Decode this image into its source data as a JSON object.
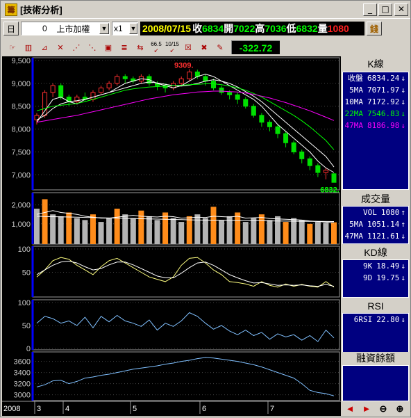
{
  "window": {
    "icon_glyph": "籌",
    "title": "[技術分析]",
    "minimize_glyph": "_",
    "maximize_glyph": "□",
    "close_glyph": "✕"
  },
  "quote_bar": {
    "period": "日",
    "symbol_code": "0",
    "symbol_name": "上市加權",
    "multiplier": "x1",
    "date": "2008/07/15",
    "close_label": "收",
    "close_value": "6834",
    "open_label": "開",
    "open_value": "7022",
    "high_label": "高",
    "high_value": "7036",
    "low_label": "低",
    "low_value": "6832",
    "volume_label": "量",
    "volume_value": "1080",
    "right_icon": "錢"
  },
  "toolbar": {
    "change": "-322.72",
    "tool_icons": [
      "cursor-icon",
      "k-chart-icon",
      "line-chart-icon",
      "trendline-icon",
      "fan-icon",
      "fan-up-icon",
      "box-icon",
      "channel-icon",
      "swap-icon",
      "date-range-icon",
      "fib-icon",
      "pencil-icon"
    ],
    "tool_texts": [
      "66.5",
      "10/15"
    ]
  },
  "panels": {
    "kline": {
      "title": "K線",
      "rows": [
        {
          "label": "收盤",
          "value": "6834.24",
          "arrow": "↓",
          "color": "#ffffff"
        },
        {
          "label": "5MA",
          "value": "7071.97",
          "arrow": "↓",
          "color": "#ffffff"
        },
        {
          "label": "10MA",
          "value": "7172.92",
          "arrow": "↓",
          "color": "#ffffff"
        },
        {
          "label": "22MA",
          "value": "7546.83",
          "arrow": "↓",
          "color": "#00ff00"
        },
        {
          "label": "47MA",
          "value": "8186.98",
          "arrow": "↓",
          "color": "#ff00ff"
        }
      ]
    },
    "volume": {
      "title": "成交量",
      "rows": [
        {
          "label": "VOL",
          "value": "1080",
          "arrow": "↑",
          "color": "#ffffff"
        },
        {
          "label": "5MA",
          "value": "1051.14",
          "arrow": "↑",
          "color": "#ffffff"
        },
        {
          "label": "47MA",
          "value": "1121.61",
          "arrow": "↓",
          "color": "#ffffff"
        }
      ]
    },
    "kd": {
      "title": "KD線",
      "rows": [
        {
          "label": "9K",
          "value": "18.49",
          "arrow": "↓",
          "color": "#ffffff"
        },
        {
          "label": "9D",
          "value": "19.75",
          "arrow": "↓",
          "color": "#ffffff"
        }
      ]
    },
    "rsi": {
      "title": "RSI",
      "rows": [
        {
          "label": "6RSI",
          "value": "22.80",
          "arrow": "↓",
          "color": "#ffffff"
        }
      ]
    },
    "margin": {
      "title": "融資餘額"
    }
  },
  "nav": {
    "left_glyph": "◄",
    "right_glyph": "►",
    "zoom_out_glyph": "⊖",
    "zoom_in_glyph": "⊕"
  },
  "chart_data": [
    {
      "type": "candlestick",
      "title": "K線",
      "yticks": [
        "9,500",
        "9,000",
        "8,500",
        "8,000",
        "7,500",
        "7,000"
      ],
      "ylim": [
        6700,
        9500
      ],
      "annotations": [
        "9309.",
        "6832."
      ],
      "x_labels": [
        "2008",
        "3",
        "4",
        "5",
        "6",
        "7"
      ],
      "ma_series": [
        {
          "name": "5MA",
          "color": "#ffffff",
          "values": [
            8150,
            8400,
            8650,
            8700,
            8600,
            8550,
            8650,
            8700,
            8750,
            8800,
            8900,
            9000,
            9050,
            9100,
            9080,
            9000,
            8950,
            8900,
            8950,
            9050,
            9150,
            9200,
            9150,
            9050,
            8950,
            8850,
            8750,
            8650,
            8500,
            8300,
            8100,
            7950,
            7800,
            7650,
            7500,
            7300,
            7150,
            7050
          ]
        },
        {
          "name": "10MA",
          "color": "#ffffff",
          "values": [
            8200,
            8300,
            8450,
            8550,
            8600,
            8620,
            8650,
            8700,
            8750,
            8800,
            8850,
            8900,
            8950,
            9000,
            9030,
            9010,
            8980,
            8950,
            8940,
            8960,
            9000,
            9050,
            9080,
            9050,
            9000,
            8920,
            8820,
            8720,
            8600,
            8450,
            8300,
            8150,
            8000,
            7850,
            7700,
            7550,
            7400,
            7170
          ]
        },
        {
          "name": "22MA",
          "color": "#00ff00",
          "values": [
            8400,
            8450,
            8500,
            8520,
            8540,
            8560,
            8600,
            8650,
            8700,
            8750,
            8800,
            8850,
            8880,
            8900,
            8920,
            8930,
            8940,
            8950,
            8960,
            8970,
            8980,
            8990,
            8990,
            8970,
            8940,
            8900,
            8850,
            8780,
            8700,
            8600,
            8500,
            8400,
            8300,
            8180,
            8050,
            7900,
            7750,
            7547
          ]
        },
        {
          "name": "47MA",
          "color": "#ff00ff",
          "values": [
            8150,
            8180,
            8210,
            8240,
            8270,
            8300,
            8340,
            8380,
            8420,
            8460,
            8500,
            8540,
            8580,
            8620,
            8660,
            8690,
            8720,
            8750,
            8770,
            8790,
            8810,
            8820,
            8830,
            8830,
            8820,
            8810,
            8790,
            8760,
            8720,
            8680,
            8630,
            8580,
            8520,
            8460,
            8400,
            8330,
            8260,
            8187
          ]
        }
      ],
      "candles": [
        [
          8200,
          8300,
          8100,
          8350
        ],
        [
          8300,
          8800,
          8250,
          8850
        ],
        [
          8800,
          8950,
          8700,
          9000
        ],
        [
          8950,
          8700,
          8650,
          9000
        ],
        [
          8700,
          8600,
          8500,
          8750
        ],
        [
          8600,
          8700,
          8550,
          8750
        ],
        [
          8700,
          8650,
          8600,
          8800
        ],
        [
          8650,
          8800,
          8600,
          8850
        ],
        [
          8800,
          8900,
          8750,
          8950
        ],
        [
          8900,
          9000,
          8850,
          9050
        ],
        [
          9000,
          9150,
          8950,
          9200
        ],
        [
          9150,
          9100,
          9000,
          9200
        ],
        [
          9100,
          9050,
          9000,
          9150
        ],
        [
          9050,
          9150,
          9000,
          9200
        ],
        [
          9150,
          9000,
          8950,
          9200
        ],
        [
          9000,
          8950,
          8850,
          9050
        ],
        [
          8950,
          8900,
          8800,
          9000
        ],
        [
          8900,
          9000,
          8850,
          9050
        ],
        [
          9000,
          9100,
          8950,
          9150
        ],
        [
          9100,
          9250,
          9050,
          9309
        ],
        [
          9250,
          9150,
          9100,
          9300
        ],
        [
          9150,
          9050,
          8950,
          9200
        ],
        [
          9050,
          8900,
          8850,
          9100
        ],
        [
          8900,
          8800,
          8750,
          8950
        ],
        [
          8800,
          8750,
          8650,
          8850
        ],
        [
          8750,
          8650,
          8550,
          8800
        ],
        [
          8650,
          8500,
          8450,
          8700
        ],
        [
          8500,
          8300,
          8250,
          8550
        ],
        [
          8300,
          8150,
          8050,
          8350
        ],
        [
          8150,
          8050,
          7950,
          8200
        ],
        [
          8050,
          7900,
          7800,
          8100
        ],
        [
          7900,
          7700,
          7600,
          7950
        ],
        [
          7700,
          7500,
          7450,
          7750
        ],
        [
          7500,
          7350,
          7250,
          7550
        ],
        [
          7350,
          7200,
          7100,
          7400
        ],
        [
          7200,
          7050,
          6950,
          7250
        ],
        [
          7050,
          7100,
          6900,
          7150
        ],
        [
          7022,
          6834,
          6832,
          7036
        ]
      ]
    },
    {
      "type": "bar",
      "title": "成交量",
      "yticks": [
        "2,000",
        "1,000"
      ],
      "ylim": [
        0,
        2500
      ],
      "values": [
        1800,
        2300,
        1500,
        1400,
        1600,
        1300,
        1200,
        1500,
        1100,
        1300,
        1800,
        1500,
        1300,
        1700,
        1400,
        1200,
        1600,
        1300,
        1100,
        1400,
        1500,
        1300,
        1900,
        1200,
        1400,
        1600,
        1100,
        1300,
        1500,
        1200,
        1400,
        1100,
        1300,
        1200,
        1000,
        1100,
        1050,
        1080
      ],
      "ma_series": [
        {
          "name": "5MA",
          "values": [
            1500,
            1600,
            1700,
            1600,
            1550,
            1500,
            1400,
            1350,
            1300,
            1300,
            1350,
            1400,
            1450,
            1400,
            1380,
            1360,
            1400,
            1380,
            1300,
            1320,
            1350,
            1330,
            1400,
            1380,
            1360,
            1400,
            1300,
            1320,
            1340,
            1280,
            1260,
            1240,
            1220,
            1200,
            1150,
            1120,
            1090,
            1051
          ]
        },
        {
          "name": "47MA",
          "values": [
            1400,
            1390,
            1380,
            1370,
            1360,
            1350,
            1340,
            1330,
            1320,
            1310,
            1300,
            1290,
            1280,
            1270,
            1260,
            1250,
            1240,
            1230,
            1220,
            1210,
            1200,
            1195,
            1190,
            1185,
            1180,
            1175,
            1170,
            1165,
            1160,
            1155,
            1150,
            1145,
            1140,
            1135,
            1130,
            1127,
            1124,
            1121
          ]
        }
      ]
    },
    {
      "type": "line",
      "title": "KD線",
      "yticks": [
        "100",
        "50"
      ],
      "ylim": [
        0,
        100
      ],
      "series": [
        {
          "name": "9K",
          "color": "#ffff80",
          "values": [
            40,
            55,
            75,
            82,
            78,
            65,
            55,
            45,
            62,
            75,
            80,
            70,
            60,
            50,
            40,
            35,
            30,
            40,
            65,
            80,
            82,
            70,
            55,
            45,
            30,
            28,
            25,
            20,
            30,
            22,
            18,
            25,
            20,
            24,
            20,
            18,
            30,
            18
          ]
        },
        {
          "name": "9D",
          "color": "#ffffff",
          "values": [
            45,
            55,
            65,
            72,
            74,
            70,
            62,
            55,
            58,
            66,
            72,
            72,
            66,
            58,
            50,
            42,
            38,
            38,
            48,
            60,
            70,
            72,
            65,
            55,
            45,
            38,
            32,
            27,
            28,
            25,
            22,
            23,
            22,
            23,
            21,
            20,
            24,
            20
          ]
        }
      ]
    },
    {
      "type": "line",
      "title": "RSI",
      "yticks": [
        "100",
        "50",
        "0"
      ],
      "ylim": [
        0,
        100
      ],
      "series": [
        {
          "name": "6RSI",
          "color": "#80c0ff",
          "values": [
            55,
            70,
            65,
            55,
            60,
            50,
            68,
            45,
            70,
            58,
            72,
            60,
            55,
            48,
            62,
            40,
            55,
            48,
            60,
            78,
            70,
            55,
            42,
            50,
            38,
            30,
            40,
            28,
            35,
            20,
            32,
            25,
            30,
            18,
            28,
            15,
            40,
            23
          ]
        }
      ]
    },
    {
      "type": "line",
      "title": "融資餘額",
      "yticks": [
        "3600",
        "3400",
        "3200",
        "3000"
      ],
      "ylim": [
        2920,
        3720
      ],
      "series": [
        {
          "name": "融資餘額",
          "color": "#80c0ff",
          "values": [
            3140,
            3180,
            3250,
            3260,
            3200,
            3240,
            3300,
            3320,
            3350,
            3370,
            3400,
            3430,
            3460,
            3480,
            3500,
            3520,
            3550,
            3570,
            3600,
            3620,
            3650,
            3670,
            3660,
            3640,
            3620,
            3600,
            3570,
            3540,
            3500,
            3450,
            3400,
            3350,
            3300,
            3200,
            3080,
            3040,
            3020,
            2980
          ]
        }
      ]
    }
  ]
}
